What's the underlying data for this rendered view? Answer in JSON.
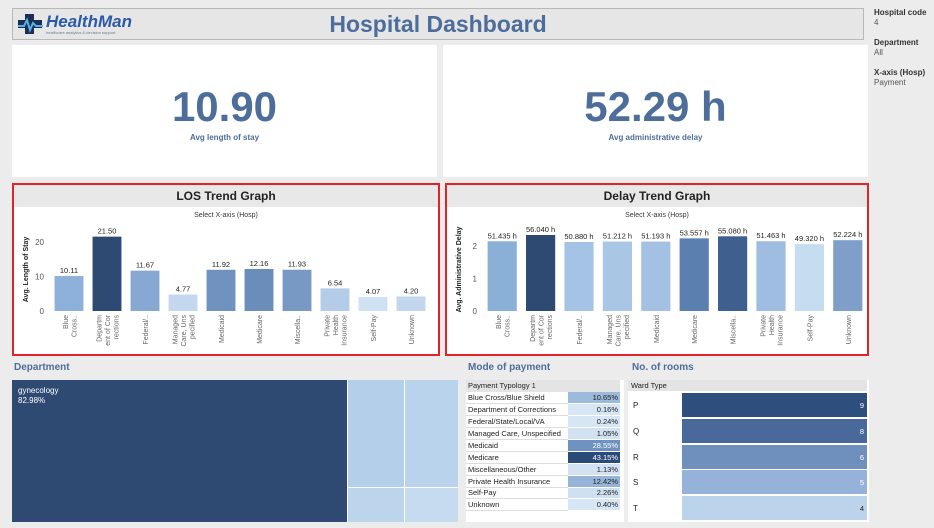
{
  "header": {
    "logo_text": "HealthMan",
    "logo_tagline": "healthcare analytics & decision support",
    "title": "Hospital Dashboard"
  },
  "filters": {
    "hospital_code_label": "Hospital code",
    "hospital_code_value": "4",
    "department_label": "Department",
    "department_value": "All",
    "xaxis_label": "X-axis (Hosp)",
    "xaxis_value": "Payment"
  },
  "kpis": {
    "los_value": "10.90",
    "los_label": "Avg length of stay",
    "delay_value": "52.29 h",
    "delay_label": "Avg administrative delay"
  },
  "chart_data": [
    {
      "type": "bar",
      "title": "LOS Trend Graph",
      "subtitle": "Select X-axis (Hosp)",
      "ylabel": "Avg. Length of Stay",
      "xlabel": "",
      "ylim": [
        0,
        24
      ],
      "yticks": [
        "0",
        "10",
        "20"
      ],
      "categories": [
        "Blue Cross..",
        "Department of Corrections",
        "Federal/..",
        "Managed Care, Unspecified",
        "Medicaid",
        "Medicare",
        "Miscella..",
        "Private Health Insurance",
        "Self-Pay",
        "Unknown"
      ],
      "tick_labels": [
        [
          "Blue",
          "Cross.."
        ],
        [
          "Departm",
          "ent of Cor",
          "rections"
        ],
        [
          "Federal/.."
        ],
        [
          "Managed",
          "Care, Uns",
          "pecified"
        ],
        [
          "Medicaid"
        ],
        [
          "Medicare"
        ],
        [
          "Miscella.."
        ],
        [
          "Private",
          "Health",
          "Insurance"
        ],
        [
          "Self-Pay"
        ],
        [
          "Unknown"
        ]
      ],
      "values": [
        10.11,
        21.5,
        11.67,
        4.77,
        11.92,
        12.16,
        11.93,
        6.54,
        4.07,
        4.2
      ],
      "value_labels": [
        "10.11",
        "21.50",
        "11.67",
        "4.77",
        "11.92",
        "12.16",
        "11.93",
        "6.54",
        "4.07",
        "4.20"
      ],
      "grid": false
    },
    {
      "type": "bar",
      "title": "Delay Trend Graph",
      "subtitle": "Select X-axis (Hosp)",
      "ylabel": "Avg. Administrative Delay",
      "xlabel": "",
      "ylim": [
        0,
        2.55
      ],
      "yticks": [
        "0",
        "1",
        "2"
      ],
      "categories": [
        "Blue Cross..",
        "Department of Corrections",
        "Federal/..",
        "Managed Care, Unspecified",
        "Medicaid",
        "Medicare",
        "Miscella..",
        "Private Health Insurance",
        "Self-Pay",
        "Unknown"
      ],
      "tick_labels": [
        [
          "Blue",
          "Cross.."
        ],
        [
          "Departm",
          "ent of Cor",
          "rections"
        ],
        [
          "Federal/.."
        ],
        [
          "Managed",
          "Care, Uns",
          "pecified"
        ],
        [
          "Medicaid"
        ],
        [
          "Medicare"
        ],
        [
          "Miscella.."
        ],
        [
          "Private",
          "Health",
          "Insurance"
        ],
        [
          "Self-Pay"
        ],
        [
          "Unknown"
        ]
      ],
      "values": [
        2.141,
        2.335,
        2.12,
        2.134,
        2.133,
        2.232,
        2.295,
        2.144,
        2.055,
        2.176
      ],
      "value_labels": [
        "51.435 h",
        "56.040 h",
        "50.880 h",
        "51.212 h",
        "51.193 h",
        "53.557 h",
        "55.080 h",
        "51.463 h",
        "49.320 h",
        "52.224 h"
      ],
      "grid": false
    }
  ],
  "department": {
    "title": "Department",
    "top_label": "gynecology",
    "top_value": "82.98%",
    "top_share": 0.8298
  },
  "payment": {
    "title": "Mode of payment",
    "header": "Payment Typology 1",
    "rows": [
      {
        "name": "Blue Cross/Blue Shield",
        "pct": "10.65%",
        "color": "#9cbadc",
        "dark": false
      },
      {
        "name": "Department of Corrections",
        "pct": "0.16%",
        "color": "#d6e6f4",
        "dark": false
      },
      {
        "name": "Federal/State/Local/VA",
        "pct": "0.24%",
        "color": "#d6e6f4",
        "dark": false
      },
      {
        "name": "Managed Care, Unspecified",
        "pct": "1.05%",
        "color": "#d2e2f2",
        "dark": false
      },
      {
        "name": "Medicaid",
        "pct": "28.55%",
        "color": "#6f93c0",
        "dark": true
      },
      {
        "name": "Medicare",
        "pct": "43.15%",
        "color": "#2a4a78",
        "dark": true
      },
      {
        "name": "Miscellaneous/Other",
        "pct": "1.13%",
        "color": "#d2e2f2",
        "dark": false
      },
      {
        "name": "Private Health Insurance",
        "pct": "12.42%",
        "color": "#95b4d8",
        "dark": false
      },
      {
        "name": "Self-Pay",
        "pct": "2.26%",
        "color": "#cfe0f1",
        "dark": false
      },
      {
        "name": "Unknown",
        "pct": "0.40%",
        "color": "#d6e6f4",
        "dark": false
      }
    ]
  },
  "rooms": {
    "title": "No. of rooms",
    "header": "Ward Type",
    "rows": [
      {
        "ward": "P",
        "value": "9",
        "color": "#2e4f7e"
      },
      {
        "ward": "Q",
        "value": "8",
        "color": "#48699a"
      },
      {
        "ward": "R",
        "value": "6",
        "color": "#6f90bc"
      },
      {
        "ward": "S",
        "value": "5",
        "color": "#95b3d8"
      },
      {
        "ward": "T",
        "value": "4",
        "color": "#bcd3ec"
      }
    ]
  }
}
